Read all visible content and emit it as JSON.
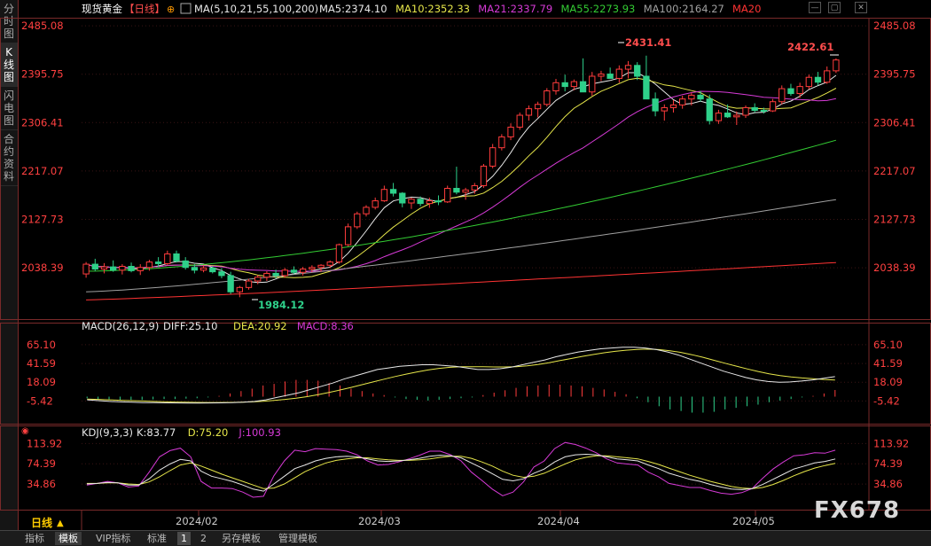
{
  "sidebar": [
    {
      "chars": [
        "分",
        "时",
        "图"
      ]
    },
    {
      "chars": [
        "K",
        "线",
        "图"
      ],
      "active": true
    },
    {
      "chars": [
        "闪",
        "电",
        "图"
      ]
    },
    {
      "chars": [
        "合",
        "约",
        "资",
        "料"
      ]
    }
  ],
  "header": {
    "symbol": "现货黄金",
    "period": "【日线】",
    "ma_prefix": "MA(5,10,21,55,100,200)",
    "ma_items": [
      {
        "text": "MA5:2374.10",
        "color": "#e8e8e8"
      },
      {
        "text": "MA10:2352.33",
        "color": "#e6e64a"
      },
      {
        "text": "MA21:2337.79",
        "color": "#d63ad6"
      },
      {
        "text": "MA55:2273.93",
        "color": "#33cc33"
      },
      {
        "text": "MA100:2164.27",
        "color": "#a0a0a0"
      },
      {
        "text": "MA20",
        "color": "#ff3333"
      }
    ]
  },
  "price_axis": [
    "2485.08",
    "2395.75",
    "2306.41",
    "2217.07",
    "2127.73",
    "2038.39"
  ],
  "annotations": {
    "high1": "2431.41",
    "high2": "2422.61",
    "low": "1984.12"
  },
  "macd_panel": {
    "label": "MACD(26,12,9)",
    "items": [
      {
        "text": "DIFF:25.10",
        "color": "#e8e8e8"
      },
      {
        "text": "DEA:20.92",
        "color": "#e6e64a"
      },
      {
        "text": "MACD:8.36",
        "color": "#d63ad6"
      }
    ],
    "axis": [
      "65.10",
      "41.59",
      "18.09",
      "-5.42"
    ]
  },
  "kdj_panel": {
    "label": "KDJ(9,3,3)",
    "items": [
      {
        "text": "K:83.77",
        "color": "#e8e8e8"
      },
      {
        "text": "D:75.20",
        "color": "#e6e64a"
      },
      {
        "text": "J:100.93",
        "color": "#d63ad6"
      }
    ],
    "axis": [
      "113.92",
      "74.39",
      "34.86"
    ]
  },
  "x_axis": {
    "period_label": "日线",
    "months": [
      "2024/02",
      "2024/03",
      "2024/04",
      "2024/05"
    ]
  },
  "footer_tabs": [
    "指标",
    "模板",
    "VIP指标",
    "标准",
    "1",
    "2",
    "另存模板",
    "管理模板"
  ],
  "watermark": "FX678",
  "colors": {
    "up": "#ff3c3c",
    "down": "#2ed08a",
    "axis_text": "#ff4040"
  },
  "chart_data": {
    "type": "candlestick",
    "title": "现货黄金 日线",
    "ylim": [
      1960,
      2500
    ],
    "candles_ohlc": [
      [
        2027,
        2049,
        2020,
        2045
      ],
      [
        2045,
        2055,
        2032,
        2036
      ],
      [
        2036,
        2047,
        2028,
        2040
      ],
      [
        2040,
        2052,
        2031,
        2034
      ],
      [
        2034,
        2045,
        2026,
        2041
      ],
      [
        2041,
        2048,
        2030,
        2033
      ],
      [
        2033,
        2045,
        2025,
        2039
      ],
      [
        2039,
        2053,
        2033,
        2049
      ],
      [
        2049,
        2058,
        2040,
        2046
      ],
      [
        2046,
        2070,
        2043,
        2064
      ],
      [
        2064,
        2070,
        2048,
        2051
      ],
      [
        2051,
        2058,
        2035,
        2039
      ],
      [
        2039,
        2045,
        2028,
        2034
      ],
      [
        2034,
        2043,
        2030,
        2038
      ],
      [
        2038,
        2041,
        2028,
        2031
      ],
      [
        2031,
        2038,
        2019,
        2024
      ],
      [
        2024,
        2031,
        1990,
        1994
      ],
      [
        1994,
        2005,
        1984,
        2002
      ],
      [
        2002,
        2018,
        1998,
        2014
      ],
      [
        2014,
        2025,
        2008,
        2021
      ],
      [
        2021,
        2032,
        2014,
        2028
      ],
      [
        2028,
        2035,
        2019,
        2024
      ],
      [
        2024,
        2038,
        2020,
        2034
      ],
      [
        2034,
        2041,
        2027,
        2030
      ],
      [
        2030,
        2040,
        2024,
        2036
      ],
      [
        2036,
        2043,
        2030,
        2039
      ],
      [
        2039,
        2045,
        2031,
        2043
      ],
      [
        2043,
        2052,
        2038,
        2049
      ],
      [
        2049,
        2083,
        2046,
        2081
      ],
      [
        2081,
        2120,
        2078,
        2114
      ],
      [
        2114,
        2142,
        2110,
        2138
      ],
      [
        2138,
        2154,
        2133,
        2150
      ],
      [
        2150,
        2168,
        2146,
        2162
      ],
      [
        2162,
        2190,
        2160,
        2183
      ],
      [
        2183,
        2195,
        2170,
        2176
      ],
      [
        2176,
        2178,
        2150,
        2158
      ],
      [
        2158,
        2168,
        2147,
        2165
      ],
      [
        2165,
        2170,
        2152,
        2157
      ],
      [
        2157,
        2168,
        2149,
        2162
      ],
      [
        2162,
        2172,
        2154,
        2160
      ],
      [
        2160,
        2190,
        2158,
        2185
      ],
      [
        2185,
        2225,
        2174,
        2178
      ],
      [
        2178,
        2186,
        2164,
        2182
      ],
      [
        2182,
        2195,
        2175,
        2190
      ],
      [
        2190,
        2230,
        2186,
        2226
      ],
      [
        2226,
        2267,
        2222,
        2260
      ],
      [
        2260,
        2285,
        2255,
        2280
      ],
      [
        2280,
        2305,
        2274,
        2298
      ],
      [
        2298,
        2325,
        2293,
        2320
      ],
      [
        2320,
        2338,
        2310,
        2332
      ],
      [
        2332,
        2345,
        2316,
        2340
      ],
      [
        2340,
        2370,
        2336,
        2365
      ],
      [
        2365,
        2387,
        2358,
        2380
      ],
      [
        2380,
        2395,
        2364,
        2373
      ],
      [
        2373,
        2386,
        2366,
        2382
      ],
      [
        2382,
        2425,
        2374,
        2363
      ],
      [
        2363,
        2400,
        2356,
        2392
      ],
      [
        2392,
        2402,
        2383,
        2396
      ],
      [
        2396,
        2408,
        2388,
        2388
      ],
      [
        2388,
        2412,
        2380,
        2405
      ],
      [
        2405,
        2420,
        2388,
        2412
      ],
      [
        2412,
        2418,
        2385,
        2392
      ],
      [
        2392,
        2430,
        2382,
        2350
      ],
      [
        2350,
        2362,
        2318,
        2328
      ],
      [
        2328,
        2340,
        2310,
        2334
      ],
      [
        2334,
        2348,
        2325,
        2339
      ],
      [
        2339,
        2356,
        2332,
        2350
      ],
      [
        2350,
        2362,
        2338,
        2357
      ],
      [
        2357,
        2365,
        2345,
        2350
      ],
      [
        2350,
        2358,
        2303,
        2310
      ],
      [
        2310,
        2330,
        2304,
        2324
      ],
      [
        2324,
        2340,
        2315,
        2317
      ],
      [
        2317,
        2327,
        2302,
        2320
      ],
      [
        2320,
        2338,
        2315,
        2334
      ],
      [
        2334,
        2342,
        2325,
        2329
      ],
      [
        2329,
        2334,
        2323,
        2328
      ],
      [
        2328,
        2350,
        2326,
        2345
      ],
      [
        2345,
        2375,
        2340,
        2369
      ],
      [
        2369,
        2378,
        2356,
        2360
      ],
      [
        2360,
        2380,
        2352,
        2373
      ],
      [
        2373,
        2395,
        2368,
        2390
      ],
      [
        2390,
        2400,
        2375,
        2381
      ],
      [
        2381,
        2410,
        2378,
        2402
      ],
      [
        2402,
        2425,
        2398,
        2422
      ]
    ],
    "moving_averages": [
      {
        "name": "MA5",
        "color": "#e8e8e8",
        "end": 2374.1
      },
      {
        "name": "MA10",
        "color": "#e6e64a",
        "end": 2352.33
      },
      {
        "name": "MA21",
        "color": "#d63ad6",
        "end": 2337.79
      },
      {
        "name": "MA55",
        "color": "#33cc33",
        "end": 2273.93
      },
      {
        "name": "MA100",
        "color": "#a0a0a0",
        "end": 2164.27
      },
      {
        "name": "MA20",
        "color": "#ff3333",
        "end": 2048
      }
    ],
    "macd": {
      "ylim": [
        -25,
        75
      ],
      "diff": [
        -4,
        -5,
        -6,
        -6.5,
        -7,
        -7.4,
        -7.6,
        -7.8,
        -7.9,
        -8,
        -8,
        -7.9,
        -7.8,
        -7.5,
        -7,
        -6,
        -4,
        -1,
        2,
        5,
        9,
        13,
        17,
        22,
        26,
        30,
        34,
        36,
        38,
        39,
        40,
        40,
        39,
        38,
        36,
        34,
        34,
        35,
        37,
        40,
        43,
        46,
        50,
        53,
        56,
        58,
        60,
        61,
        62,
        62,
        61,
        59,
        56,
        52,
        47,
        42,
        37,
        32,
        28,
        24,
        21,
        19,
        18,
        18.5,
        19.5,
        21,
        23,
        25.1
      ],
      "dea": [
        -3,
        -3.5,
        -4,
        -4.5,
        -5,
        -5.5,
        -6,
        -6.4,
        -6.8,
        -7,
        -7.2,
        -7.3,
        -7.3,
        -7.2,
        -7,
        -6.6,
        -5.9,
        -4.8,
        -3.5,
        -1.9,
        0,
        2.5,
        5.3,
        8.3,
        11.6,
        15,
        18.5,
        21.9,
        25.2,
        28.2,
        31,
        33.5,
        35.5,
        36.8,
        37.4,
        37.5,
        37.4,
        37.2,
        37.2,
        37.6,
        38.6,
        40.3,
        42.6,
        45.2,
        47.8,
        50.4,
        52.8,
        55,
        56.8,
        58.2,
        59.2,
        59.5,
        59,
        57.6,
        55.4,
        52.6,
        49.3,
        45.6,
        41.9,
        38.3,
        34.8,
        31.5,
        28.7,
        26.4,
        24.7,
        23.4,
        22.6,
        21.6,
        20.9
      ],
      "hist": [
        -2,
        -3,
        -3.5,
        -4,
        -4,
        -4,
        -3.5,
        -3,
        -3,
        -2.5,
        -2,
        -1,
        1,
        4,
        7,
        10,
        14,
        16,
        19,
        21,
        21,
        20,
        17,
        14,
        10,
        7,
        4,
        2,
        -1,
        -3,
        -4,
        -5,
        -4,
        -3,
        -2,
        -1,
        2,
        5,
        8,
        11,
        13,
        14,
        15,
        15,
        14,
        13,
        11,
        9,
        6,
        3,
        -2,
        -7,
        -12,
        -16,
        -18,
        -20,
        -20,
        -19,
        -16,
        -14,
        -12,
        -10,
        -7,
        -5,
        -3,
        -1,
        1,
        4,
        8.36
      ]
    },
    "kdj": {
      "ylim": [
        -10,
        125
      ],
      "k": [
        35,
        36,
        38,
        37,
        33,
        33,
        45,
        62,
        74,
        83,
        80,
        60,
        50,
        45,
        40,
        33,
        25,
        21,
        35,
        50,
        65,
        72,
        80,
        85,
        88,
        89,
        88,
        84,
        80,
        79,
        80,
        82,
        85,
        89,
        91,
        90,
        86,
        76,
        66,
        55,
        44,
        41,
        45,
        56,
        64,
        78,
        88,
        92,
        93,
        92,
        88,
        84,
        82,
        80,
        72,
        65,
        56,
        50,
        44,
        40,
        34,
        29,
        25,
        24,
        26,
        34,
        44,
        54,
        64,
        70,
        76,
        79,
        83.77
      ],
      "d": [
        36,
        36,
        37,
        37,
        35,
        34,
        39,
        49,
        61,
        72,
        76,
        70,
        62,
        54,
        47,
        40,
        33,
        26,
        27,
        35,
        47,
        59,
        68,
        76,
        81,
        84,
        86,
        86,
        84,
        82,
        81,
        81,
        82,
        84,
        87,
        89,
        89,
        85,
        78,
        70,
        60,
        52,
        48,
        50,
        56,
        65,
        74,
        82,
        87,
        90,
        90,
        88,
        86,
        84,
        79,
        73,
        66,
        59,
        52,
        46,
        40,
        35,
        30,
        27,
        26,
        28,
        34,
        42,
        51,
        59,
        66,
        71,
        75.2
      ],
      "j": [
        33,
        36,
        40,
        37,
        29,
        31,
        58,
        88,
        100,
        105,
        88,
        40,
        27,
        27,
        26,
        19,
        9,
        11,
        51,
        80,
        101,
        98,
        104,
        103,
        102,
        99,
        92,
        80,
        72,
        73,
        78,
        84,
        91,
        99,
        99,
        92,
        80,
        58,
        42,
        25,
        12,
        19,
        39,
        68,
        80,
        104,
        116,
        112,
        105,
        96,
        84,
        76,
        74,
        72,
        58,
        49,
        36,
        32,
        28,
        28,
        22,
        17,
        15,
        18,
        26,
        46,
        64,
        78,
        90,
        92,
        96,
        95,
        100.93
      ]
    }
  }
}
